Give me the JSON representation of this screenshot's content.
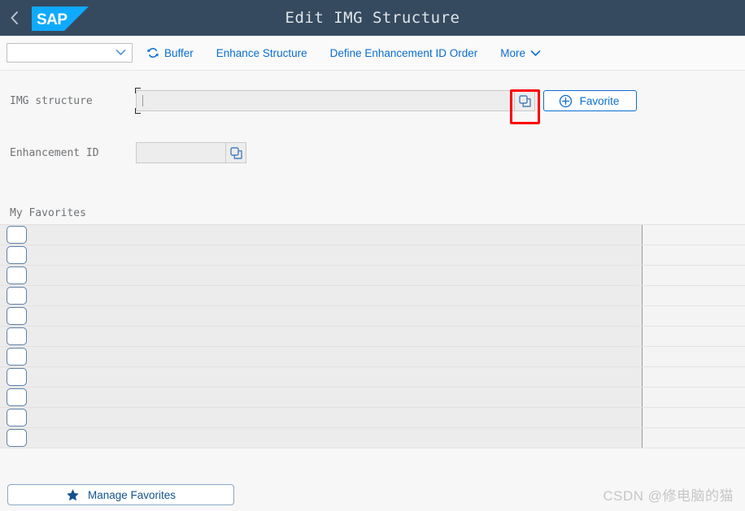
{
  "header": {
    "back_icon": "chevron-left-icon",
    "logo_text": "SAP",
    "title": "Edit IMG Structure",
    "bg_color": "#354a5f",
    "logo_color": "#0faaff"
  },
  "toolbar": {
    "variant_select": {
      "value": "",
      "placeholder": "",
      "chevron_icon": "chevron-down-icon"
    },
    "buttons": [
      {
        "label": "Buffer",
        "icon": "refresh-icon"
      },
      {
        "label": "Enhance Structure",
        "icon": ""
      },
      {
        "label": "Define Enhancement ID Order",
        "icon": ""
      },
      {
        "label": "More",
        "icon": "chevron-down-icon"
      }
    ],
    "link_color": "#0a6ed1"
  },
  "form": {
    "img_structure": {
      "label": "IMG structure",
      "value": "",
      "placeholder": "",
      "value_help_icon": "value-help-icon",
      "highlighted": true
    },
    "enhancement_id": {
      "label": "Enhancement ID",
      "value": "",
      "placeholder": "",
      "value_help_icon": "value-help-icon"
    },
    "favorite_button": {
      "label": "Favorite",
      "icon": "plus-circle-icon"
    },
    "highlight_color": "#ff0000"
  },
  "favorites": {
    "title": "My Favorites",
    "rows": [
      {
        "checked": false,
        "text": ""
      },
      {
        "checked": false,
        "text": ""
      },
      {
        "checked": false,
        "text": ""
      },
      {
        "checked": false,
        "text": ""
      },
      {
        "checked": false,
        "text": ""
      },
      {
        "checked": false,
        "text": ""
      },
      {
        "checked": false,
        "text": ""
      },
      {
        "checked": false,
        "text": ""
      },
      {
        "checked": false,
        "text": ""
      },
      {
        "checked": false,
        "text": ""
      },
      {
        "checked": false,
        "text": ""
      }
    ]
  },
  "footer": {
    "manage_button": {
      "label": "Manage Favorites",
      "icon": "star-icon"
    }
  },
  "watermark": {
    "text": "CSDN @修电脑的猫"
  }
}
